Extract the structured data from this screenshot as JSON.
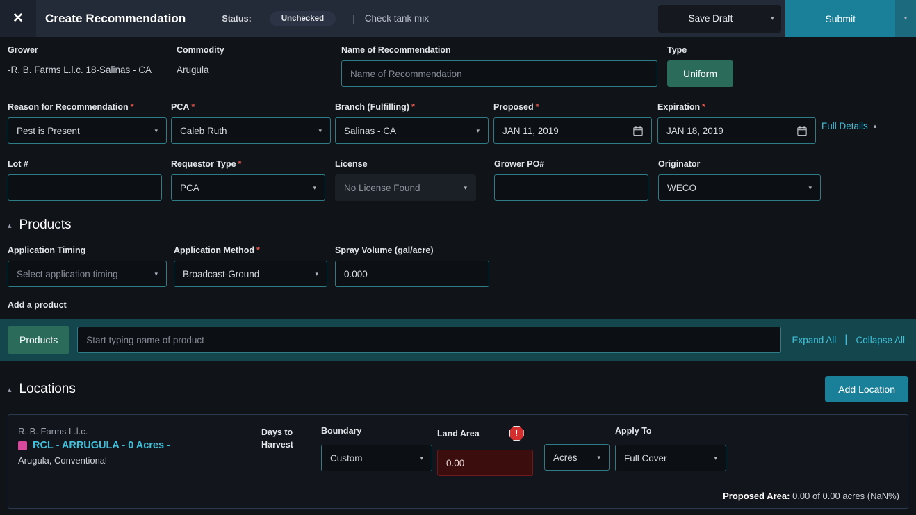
{
  "header": {
    "close_icon": "close-icon",
    "title": "Create Recommendation",
    "status_label": "Status:",
    "status_value": "Unchecked",
    "separator": "|",
    "tank_mix": "Check tank mix",
    "save_draft": "Save Draft",
    "submit": "Submit",
    "accent_submit": "#1a8099"
  },
  "top": {
    "grower_label": "Grower",
    "grower_value": "-R. B. Farms L.l.c. 18-Salinas - CA",
    "commodity_label": "Commodity",
    "commodity_value": "Arugula",
    "name_label": "Name of Recommendation",
    "name_placeholder": "Name of Recommendation",
    "name_value": "",
    "type_label": "Type",
    "type_value": "Uniform"
  },
  "row2": {
    "reason_label": "Reason for Recommendation",
    "reason_value": "Pest is Present",
    "pca_label": "PCA",
    "pca_value": "Caleb Ruth",
    "branch_label": "Branch (Fulfilling)",
    "branch_value": "Salinas - CA",
    "proposed_label": "Proposed",
    "proposed_value": "JAN 11, 2019",
    "expiration_label": "Expiration",
    "expiration_value": "JAN 18, 2019",
    "full_details": "Full Details",
    "required_mark": "*"
  },
  "row3": {
    "lot_label": "Lot #",
    "lot_value": "",
    "requestor_label": "Requestor Type",
    "requestor_value": "PCA",
    "license_label": "License",
    "license_value": "No License Found",
    "po_label": "Grower PO#",
    "po_value": "",
    "originator_label": "Originator",
    "originator_value": "WECO"
  },
  "products": {
    "section_title": "Products",
    "timing_label": "Application Timing",
    "timing_placeholder": "Select application timing",
    "method_label": "Application Method",
    "method_value": "Broadcast-Ground",
    "spray_label": "Spray Volume (gal/acre)",
    "spray_value": "0.000",
    "add_product_label": "Add a product",
    "products_button": "Products",
    "search_placeholder": "Start typing name of product",
    "expand_all": "Expand All",
    "collapse_all": "Collapse All",
    "links_separator": "|"
  },
  "locations": {
    "section_title": "Locations",
    "add_location": "Add Location",
    "card": {
      "grower_name": "R. B. Farms L.l.c.",
      "field_link": "RCL - ARRUGULA - 0 Acres -",
      "swatch_color": "#d8489c",
      "field_sub": "Arugula, Conventional",
      "days_to_harvest_label": "Days to Harvest",
      "days_to_harvest_value": "-",
      "boundary_label": "Boundary",
      "boundary_value": "Custom",
      "land_area_label": "Land Area",
      "land_area_value": "0.00",
      "land_area_error": true,
      "unit_value": "Acres",
      "apply_to_label": "Apply To",
      "apply_to_value": "Full Cover",
      "proposed_area_label": "Proposed Area:",
      "proposed_area_value": "0.00 of 0.00 acres (NaN%)"
    }
  }
}
